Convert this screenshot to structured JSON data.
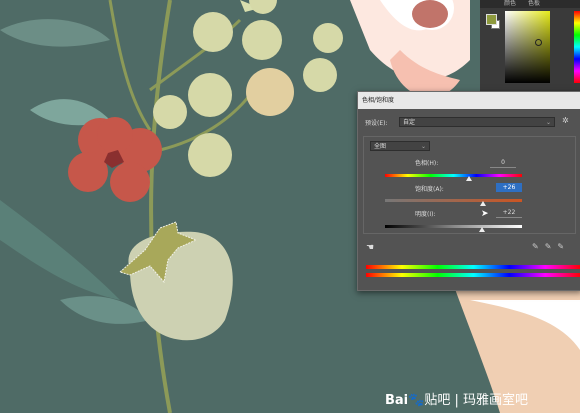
{
  "color_panel": {
    "tab_labels": [
      "颜色",
      "色板"
    ],
    "foreground_color": "#8e9a3e",
    "background_color": "#ffffff",
    "picker_hue": "#e6ea1a"
  },
  "dialog": {
    "title": "色相/饱和度",
    "preset_label": "预设(E):",
    "preset_value": "自定",
    "channel_value": "全图",
    "hue_label": "色相(H):",
    "hue_value": "0",
    "saturation_label": "饱和度(A):",
    "saturation_value": "+26",
    "lightness_label": "明度(I):",
    "lightness_value": "+22"
  },
  "watermark": {
    "logo_text": "Bai",
    "logo_suffix": "贴吧",
    "separator": "|",
    "author": "玛雅画室吧"
  }
}
